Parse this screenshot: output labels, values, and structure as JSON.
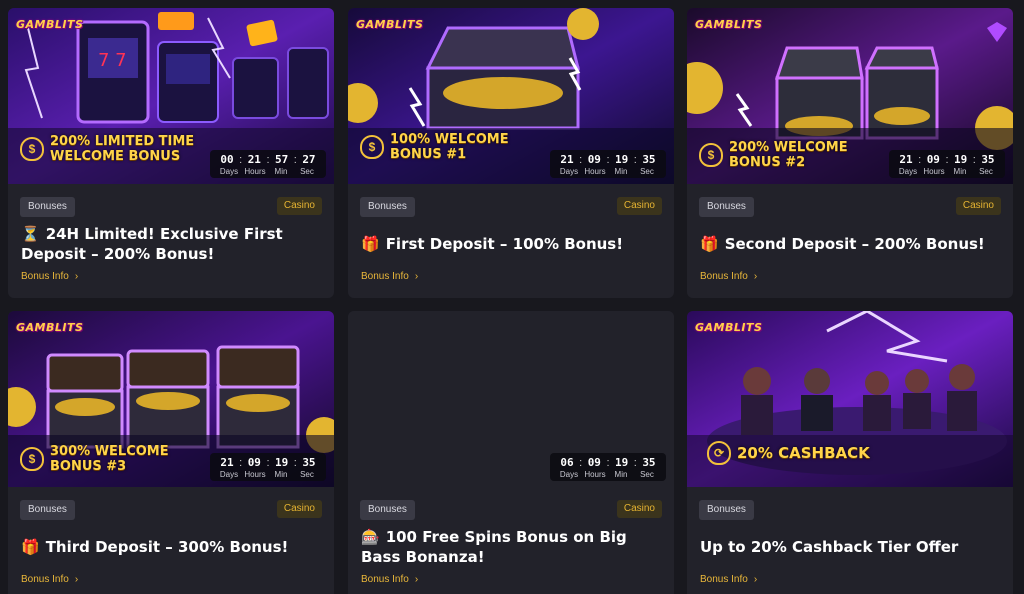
{
  "colors": {
    "background": "#18181e",
    "card": "#22222a",
    "accent_gold": "#e9b73a",
    "bonus_badge": "#3a3a45",
    "casino_badge": "#3b341c"
  },
  "countdown_labels": [
    "Days",
    "Hours",
    "Min",
    "Sec"
  ],
  "cards": [
    {
      "logo": "GAMBLITS",
      "promo_text": "200% LIMITED TIME\nWELCOME BONUS",
      "promo_icon": "money-bag-icon",
      "countdown": [
        "00",
        "21",
        "57",
        "27"
      ],
      "category": "Bonuses",
      "type": "Casino",
      "title_emoji": "⏳",
      "title": "24H Limited! Exclusive First Deposit – 200% Bonus!",
      "link": "Bonus Info"
    },
    {
      "logo": "GAMBLITS",
      "promo_text": "100% WELCOME\nBONUS #1",
      "promo_icon": "money-bag-icon",
      "countdown": [
        "21",
        "09",
        "19",
        "35"
      ],
      "category": "Bonuses",
      "type": "Casino",
      "title_emoji": "🎁",
      "title": "First Deposit – 100% Bonus!",
      "link": "Bonus Info"
    },
    {
      "logo": "GAMBLITS",
      "promo_text": "200% WELCOME\nBONUS #2",
      "promo_icon": "money-bag-icon",
      "countdown": [
        "21",
        "09",
        "19",
        "35"
      ],
      "category": "Bonuses",
      "type": "Casino",
      "title_emoji": "🎁",
      "title": "Second Deposit – 200% Bonus!",
      "link": "Bonus Info"
    },
    {
      "logo": "GAMBLITS",
      "promo_text": "300% WELCOME\nBONUS #3",
      "promo_icon": "money-bag-icon",
      "countdown": [
        "21",
        "09",
        "19",
        "35"
      ],
      "category": "Bonuses",
      "type": "Casino",
      "title_emoji": "🎁",
      "title": "Third Deposit – 300% Bonus!",
      "link": "Bonus Info"
    },
    {
      "countdown": [
        "06",
        "09",
        "19",
        "35"
      ],
      "category": "Bonuses",
      "type": "Casino",
      "title_emoji": "🎰",
      "title": "100 Free Spins Bonus on Big Bass Bonanza!",
      "link": "Bonus Info"
    },
    {
      "logo": "GAMBLITS",
      "promo_text": "20% CASHBACK",
      "promo_icon": "cashback-arrows-icon",
      "category": "Bonuses",
      "title": "Up to 20% Cashback Tier Offer",
      "link": "Bonus Info"
    }
  ]
}
